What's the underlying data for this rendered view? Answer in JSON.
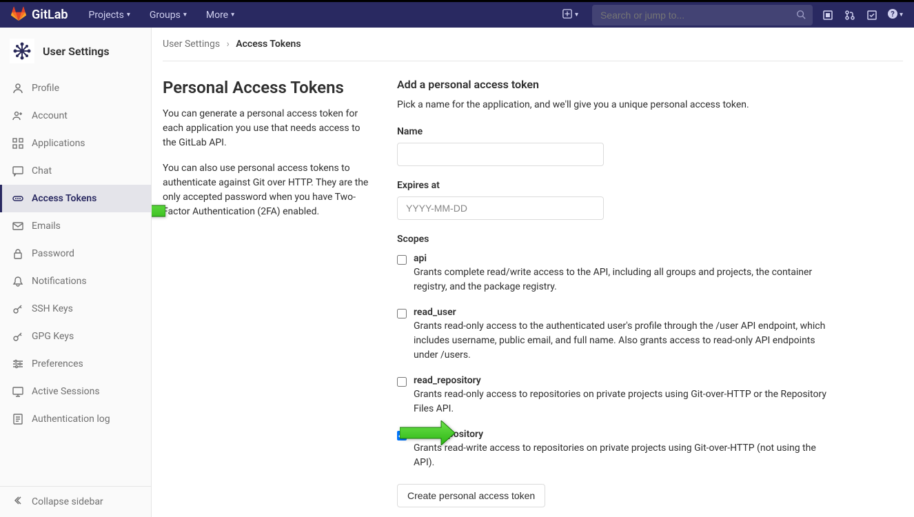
{
  "topbar": {
    "brand": "GitLab",
    "nav": [
      {
        "label": "Projects"
      },
      {
        "label": "Groups"
      },
      {
        "label": "More"
      }
    ],
    "search_placeholder": "Search or jump to..."
  },
  "sidebar": {
    "title": "User Settings",
    "items": [
      {
        "icon": "profile-icon",
        "label": "Profile"
      },
      {
        "icon": "account-icon",
        "label": "Account"
      },
      {
        "icon": "applications-icon",
        "label": "Applications"
      },
      {
        "icon": "chat-icon",
        "label": "Chat"
      },
      {
        "icon": "token-icon",
        "label": "Access Tokens",
        "active": true
      },
      {
        "icon": "emails-icon",
        "label": "Emails"
      },
      {
        "icon": "password-icon",
        "label": "Password"
      },
      {
        "icon": "notifications-icon",
        "label": "Notifications"
      },
      {
        "icon": "key-icon",
        "label": "SSH Keys"
      },
      {
        "icon": "key-icon",
        "label": "GPG Keys"
      },
      {
        "icon": "preferences-icon",
        "label": "Preferences"
      },
      {
        "icon": "sessions-icon",
        "label": "Active Sessions"
      },
      {
        "icon": "log-icon",
        "label": "Authentication log"
      }
    ],
    "collapse_label": "Collapse sidebar"
  },
  "breadcrumb": {
    "root": "User Settings",
    "current": "Access Tokens"
  },
  "page": {
    "heading": "Personal Access Tokens",
    "desc1": "You can generate a personal access token for each application you use that needs access to the GitLab API.",
    "desc2": "You can also use personal access tokens to authenticate against Git over HTTP. They are the only accepted password when you have Two-Factor Authentication (2FA) enabled."
  },
  "form": {
    "title": "Add a personal access token",
    "intro": "Pick a name for the application, and we'll give you a unique personal access token.",
    "name_label": "Name",
    "name_value": "",
    "expires_label": "Expires at",
    "expires_placeholder": "YYYY-MM-DD",
    "expires_value": "",
    "scopes_label": "Scopes",
    "scopes": [
      {
        "key": "api",
        "checked": false,
        "desc": "Grants complete read/write access to the API, including all groups and projects, the container registry, and the package registry."
      },
      {
        "key": "read_user",
        "checked": false,
        "desc": "Grants read-only access to the authenticated user's profile through the /user API endpoint, which includes username, public email, and full name. Also grants access to read-only API endpoints under /users."
      },
      {
        "key": "read_repository",
        "checked": false,
        "desc": "Grants read-only access to repositories on private projects using Git-over-HTTP or the Repository Files API."
      },
      {
        "key": "write_repository",
        "checked": true,
        "desc": "Grants read-write access to repositories on private projects using Git-over-HTTP (not using the API)."
      }
    ],
    "submit_label": "Create personal access token"
  }
}
